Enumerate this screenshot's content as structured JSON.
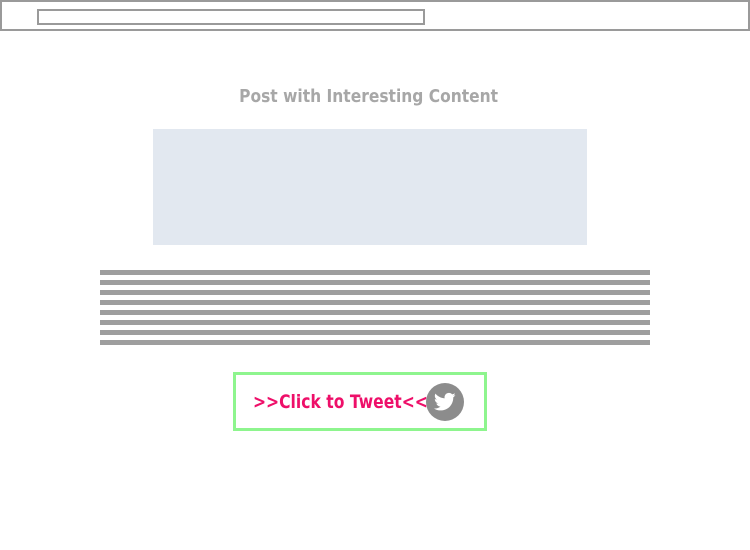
{
  "post": {
    "title": "Post with Interesting Content"
  },
  "tweet": {
    "label": ">>Click to Tweet<<",
    "icon": "twitter-bird-icon",
    "border_color": "#8ef58e",
    "text_color": "#ee0f69"
  },
  "colors": {
    "image_placeholder": "#e2e8f0",
    "text_lines": "#9e9e9e"
  }
}
